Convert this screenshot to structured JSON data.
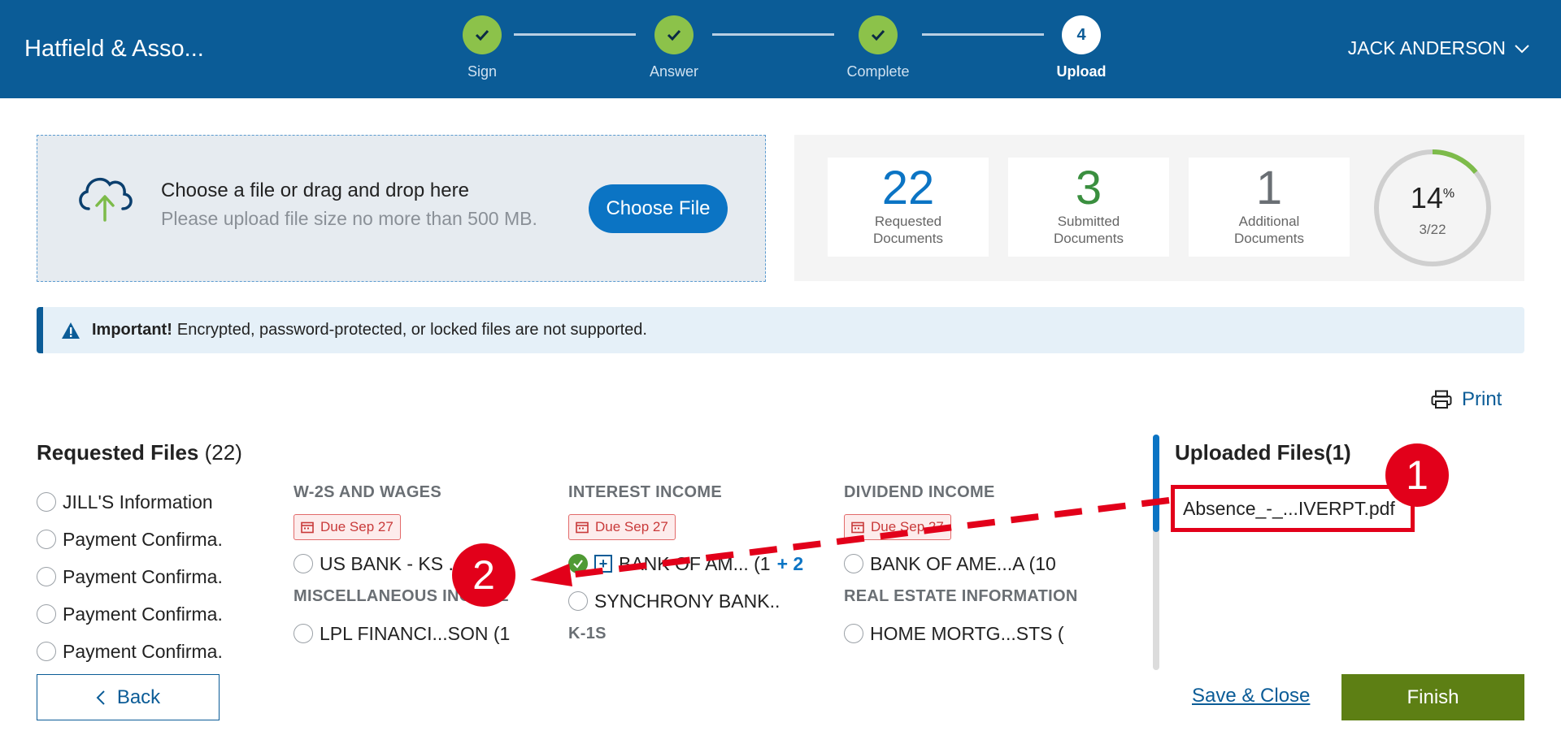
{
  "header": {
    "brand": "Hatfield & Asso...",
    "user_name": "JACK ANDERSON",
    "steps": [
      {
        "label": "Sign",
        "state": "done"
      },
      {
        "label": "Answer",
        "state": "done"
      },
      {
        "label": "Complete",
        "state": "done"
      },
      {
        "label": "Upload",
        "state": "current",
        "number": "4"
      }
    ]
  },
  "upload": {
    "title": "Choose a file or drag and drop here",
    "subtitle": "Please upload file size no more than 500 MB.",
    "button": "Choose File"
  },
  "stats": [
    {
      "value": "22",
      "line1": "Requested",
      "line2": "Documents",
      "color": "#0b74c4"
    },
    {
      "value": "3",
      "line1": "Submitted",
      "line2": "Documents",
      "color": "#3a8f3f"
    },
    {
      "value": "1",
      "line1": "Additional",
      "line2": "Documents",
      "color": "#6a6f74"
    }
  ],
  "progress": {
    "percent": "14",
    "percent_sign": "%",
    "count": "3/22",
    "fraction": 0.14
  },
  "alert": {
    "strong": "Important!",
    "text": "Encrypted, password-protected, or locked files are not supported."
  },
  "print_label": "Print",
  "requested": {
    "title": "Requested Files",
    "count": "(22)",
    "left_items": [
      "JILL'S Information",
      "Payment Confirma.",
      "Payment Confirma.",
      "Payment Confirma.",
      "Payment Confirma."
    ],
    "columns": [
      {
        "heading": "W-2S AND WAGES",
        "due": "Due Sep 27",
        "items": [
          "US BANK - KS ..."
        ],
        "heading2": "MISCELLANEOUS INCOME",
        "items2": [
          "LPL FINANCI...SON (1"
        ]
      },
      {
        "heading": "INTEREST INCOME",
        "due": "Due Sep 27",
        "items": [
          "BANK OF AM... (1",
          "SYNCHRONY BANK.."
        ],
        "more": "+ 2",
        "heading2": "K-1S"
      },
      {
        "heading": "DIVIDEND INCOME",
        "due": "Due Sep 27",
        "items": [
          "BANK OF AME...A (10"
        ],
        "heading2": "REAL ESTATE INFORMATION",
        "items2": [
          "HOME MORTG...STS ("
        ]
      }
    ]
  },
  "uploaded": {
    "title": "Uploaded Files(1)",
    "files": [
      "Absence_-_...IVERPT.pdf"
    ]
  },
  "annotations": {
    "marker1": "1",
    "marker2": "2",
    "color": "#e2001a"
  },
  "footer": {
    "back": "Back",
    "save_close": "Save & Close",
    "finish": "Finish"
  }
}
